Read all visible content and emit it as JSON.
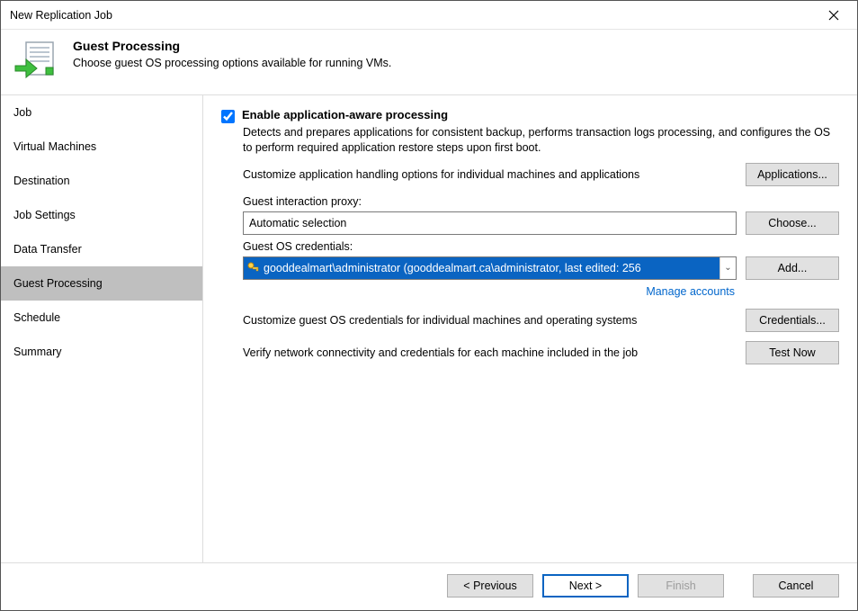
{
  "window": {
    "title": "New Replication Job"
  },
  "header": {
    "title": "Guest Processing",
    "subtitle": "Choose guest OS processing options available for running VMs."
  },
  "sidebar": {
    "items": [
      {
        "label": "Job"
      },
      {
        "label": "Virtual Machines"
      },
      {
        "label": "Destination"
      },
      {
        "label": "Job Settings"
      },
      {
        "label": "Data Transfer"
      },
      {
        "label": "Guest Processing",
        "active": true
      },
      {
        "label": "Schedule"
      },
      {
        "label": "Summary"
      }
    ]
  },
  "main": {
    "enable_checkbox_label": "Enable application-aware processing",
    "enable_checkbox_checked": true,
    "enable_description": "Detects and prepares applications for consistent backup, performs transaction logs processing, and configures the OS to perform required application restore steps upon first boot.",
    "customize_apps_label": "Customize application handling options for individual machines and applications",
    "applications_button": "Applications...",
    "proxy_label": "Guest interaction proxy:",
    "proxy_value": "Automatic selection",
    "choose_button": "Choose...",
    "credentials_label": "Guest OS credentials:",
    "credentials_value": "gooddealmart\\administrator (gooddealmart.ca\\administrator, last edited: 256",
    "add_button": "Add...",
    "manage_accounts": "Manage accounts",
    "customize_creds_label": "Customize guest OS credentials for individual machines and operating systems",
    "credentials_button": "Credentials...",
    "verify_label": "Verify network connectivity and credentials for each machine included in the job",
    "test_now_button": "Test Now"
  },
  "footer": {
    "previous": "< Previous",
    "next": "Next >",
    "finish": "Finish",
    "cancel": "Cancel"
  }
}
